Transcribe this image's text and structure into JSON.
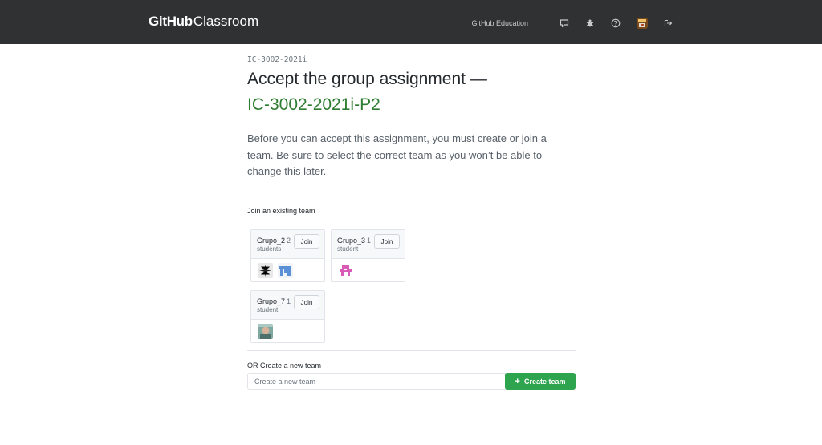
{
  "header": {
    "brand_bold": "GitHub",
    "brand_light": "Classroom",
    "education_link": "GitHub Education",
    "icons": [
      "comment-icon",
      "bug-icon",
      "question-icon",
      "user-avatar",
      "sign-out-icon"
    ]
  },
  "course_name": "IC-3002-2021i",
  "heading": {
    "line1": "Accept the group assignment —",
    "assignment": "IC-3002-2021i-P2"
  },
  "lead": "Before you can accept this assignment, you must create or join a team. Be sure to select the correct team as you won’t be able to change this later.",
  "join_section_title": "Join an existing team",
  "teams": [
    {
      "name": "Grupo_2",
      "count": "2",
      "unit": "students",
      "join_label": "Join"
    },
    {
      "name": "Grupo_3",
      "count": "1",
      "unit": "student",
      "join_label": "Join"
    },
    {
      "name": "Grupo_7",
      "count": "1",
      "unit": "student",
      "join_label": "Join"
    }
  ],
  "create_section": {
    "title": "OR Create a new team",
    "placeholder": "Create a new team",
    "button_label": "Create team"
  },
  "colors": {
    "header_bg": "#2f3132",
    "assignment_green": "#2f7d32",
    "create_button": "#2ea44f"
  }
}
